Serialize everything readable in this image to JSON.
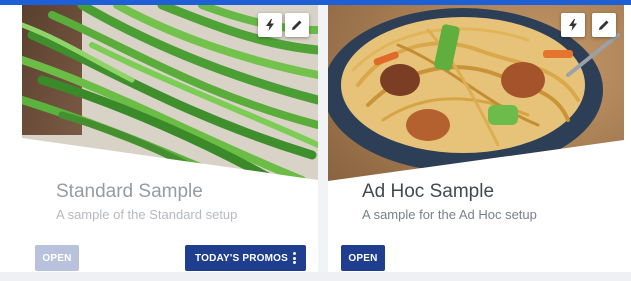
{
  "cards": [
    {
      "title": "Standard Sample",
      "description": "A sample of the Standard setup",
      "image": "green-beans-photo",
      "actions": {
        "quick_icon": "bolt-icon",
        "edit_icon": "pencil-icon"
      },
      "open_label": "OPEN",
      "promos_label": "TODAY'S PROMOS",
      "menu_icon": "kebab-menu-icon"
    },
    {
      "title": "Ad Hoc Sample",
      "description": "A sample for the Ad Hoc setup",
      "image": "noodle-bowl-photo",
      "actions": {
        "quick_icon": "bolt-icon",
        "edit_icon": "pencil-icon"
      },
      "open_label": "OPEN"
    }
  ],
  "colors": {
    "primary": "#1f3e8f",
    "disabled_button": "#b9c2dc",
    "accent_strip": "#1f5fd6"
  }
}
